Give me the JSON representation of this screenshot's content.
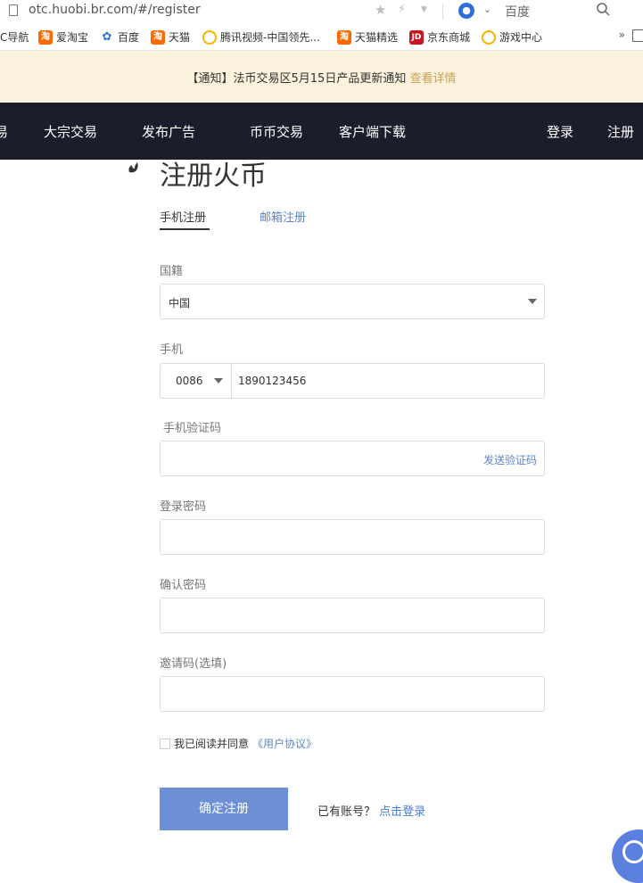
{
  "browser": {
    "url": "otc.huobi.br.com/#/register",
    "search_engine": "百度",
    "bookmarks": [
      {
        "label": "C导航",
        "icon": "none"
      },
      {
        "label": "爱淘宝",
        "icon": "taobao-icon"
      },
      {
        "label": "百度",
        "icon": "baidu-paw-icon"
      },
      {
        "label": "天猫",
        "icon": "taobao-icon"
      },
      {
        "label": "腾讯视频-中国领先...",
        "icon": "tencent-video-icon"
      },
      {
        "label": "天猫精选",
        "icon": "taobao-icon"
      },
      {
        "label": "京东商城",
        "icon": "jd-icon"
      },
      {
        "label": "游戏中心",
        "icon": "tencent-video-icon"
      }
    ],
    "more": "»"
  },
  "notice": {
    "text": "【通知】法币交易区5月15日产品更新通知",
    "link": "查看详情"
  },
  "nav": {
    "partial": "易",
    "items": [
      "大宗交易",
      "发布广告",
      "币币交易",
      "客户端下载"
    ],
    "login": "登录",
    "register": "注册"
  },
  "form": {
    "title": "注册火币",
    "tabs": {
      "phone": "手机注册",
      "email": "邮箱注册"
    },
    "nationality_label": "国籍",
    "nationality_value": "中国",
    "phone_label": "手机",
    "country_code": "0086",
    "phone_value": "1890123456",
    "code_label": "手机验证码",
    "send_code": "发送验证码",
    "password_label": "登录密码",
    "confirm_label": "确认密码",
    "invite_label": "邀请码(选填)",
    "agree_text": "我已阅读并同意",
    "agreement_link": "《用户协议》",
    "submit": "确定注册",
    "have_account": "已有账号？",
    "login_link": "点击登录"
  },
  "colors": {
    "nav_bg": "#1c1d2b",
    "notice_bg": "#faf2dd",
    "notice_link": "#c8a357",
    "link_blue": "#5b86c9",
    "submit_bg": "#6c8fd6"
  }
}
